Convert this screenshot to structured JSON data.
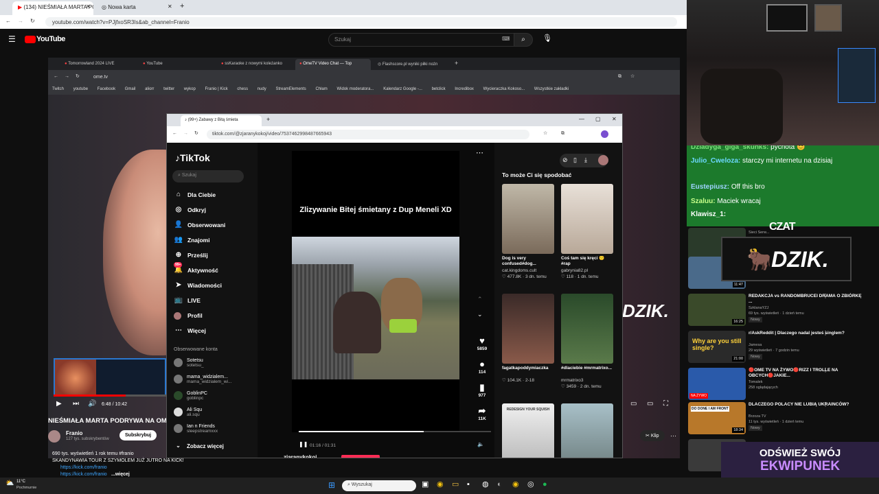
{
  "outer_browser": {
    "tabs": [
      {
        "label": "(134) NIEŚMIAŁA MARTA PODR",
        "active": true
      },
      {
        "label": "Nowa karta",
        "active": false
      }
    ],
    "url": "youtube.com/watch?v=PJjfxoSR3Is&ab_channel=Franio"
  },
  "youtube": {
    "logo": "YouTube",
    "search_placeholder": "Szukaj",
    "video_title": "NIEŚMIAŁA MARTA PODRYWA NA OM",
    "channel": "Franio",
    "subs": "127 tys. subskrybentów",
    "subscribe_label": "Subskrybuj",
    "views_line": "690 tys. wyświetleń  1 rok temu  #franio",
    "desc_line1": "SKANDYNAWIA TOUR Z SZYMOLEM JUŻ JUTRO NA KICK!",
    "desc_link1": "https://kick.com/franio",
    "desc_link2": "https://kick.com/franio",
    "more_label": "...więcej",
    "player_time": "6:48 / 10:42",
    "clip_label": "Klip"
  },
  "inner_browser": {
    "tabs": [
      {
        "label": "Tomorrowland 2024 LIVE",
        "active": false
      },
      {
        "label": "YouTube",
        "active": false
      },
      {
        "label": "ssKaraoke z nowymi koleżanko",
        "active": false
      },
      {
        "label": "OmeTV Video Chat — Top",
        "active": true
      },
      {
        "label": "Flashscore.pl wyniki piłki nożn",
        "active": false
      }
    ],
    "url": "ome.tv",
    "bookmarks": [
      "Twitch",
      "youtube",
      "Facebook",
      "Gmail",
      "aliorr",
      "twitter",
      "wykop",
      "Franio | Kick",
      "chess",
      "nudy",
      "StreamElements",
      "Chłam",
      "Widok moderatora...",
      "Kalendarz Google -...",
      "betclick",
      "Incredibox",
      "Wycieraczka Kokoso...",
      "Wszystkie zakładki"
    ],
    "overlay_text": "DZIK."
  },
  "tiktok": {
    "tab_label": "(99+) Zabawy z Bitą śmieta",
    "url": "tiktok.com/@zjaranykokoj/video/7537462998487665943",
    "logo": "TikTok",
    "search_placeholder": "Szukaj",
    "nav": [
      "Dla Ciebie",
      "Odkryj",
      "Obserwowani",
      "Znajomi",
      "Prześlij",
      "Aktywność",
      "Wiadomości",
      "LIVE",
      "Profil",
      "Więcej"
    ],
    "nav_badge": "99+",
    "following_title": "Obserwowane konta",
    "following": [
      {
        "name": "Sotetsu",
        "handle": "sotetsu_"
      },
      {
        "name": "mama_widzialem...",
        "handle": "mama_widzialem_wi..."
      },
      {
        "name": "GoblinPC",
        "handle": "goblinpc"
      },
      {
        "name": "Ali Squ",
        "handle": "ali.squ"
      },
      {
        "name": "Ian n Friends",
        "handle": "sleepstreamxxx"
      }
    ],
    "see_more": "Zobacz więcej",
    "video_caption": "Zlizywanie Bitej śmietany z Dup Meneli XD",
    "likes": "5859",
    "comments": "114",
    "saves": "977",
    "shares": "11K",
    "time": "01:16 / 01:31",
    "author": "zjaranykokoj",
    "suggest_title": "To może Ci się spodobać",
    "cards": [
      {
        "title": "Dog is very confused#dog...",
        "user": "cat.kingdoms.cult",
        "stats": "♡ 477.8K · 3 dn. temu",
        "color": "#8a7a6a"
      },
      {
        "title": "Coś tam się kręci 🙂 #rap",
        "user": "gabrynia82.pl",
        "stats": "♡ 118 · 1 dn. temu",
        "color": "#d8d0c8"
      },
      {
        "title": "fagatkapoddymiaczka",
        "user": "",
        "stats": "♡ 104.1K · 2-18",
        "color": "#6a4a42"
      },
      {
        "title": "#dlaciebie #mrmatrixo...",
        "user": "mrmatrixo3",
        "stats": "♡ 3459 · 2 dn. temu",
        "color": "#3a5a3a"
      },
      {
        "title": "",
        "user": "",
        "stats": "",
        "color": "#cfcfcf"
      },
      {
        "title": "",
        "user": "",
        "stats": "",
        "color": "#8aa0a8"
      }
    ],
    "card5_text": "REDESIGN YOUR SQUISH"
  },
  "stream": {
    "chat": [
      {
        "name": "Dziadyga_giga_skunks:",
        "text": "pycnota 😊",
        "color": "#7be07b"
      },
      {
        "name": "Julio_Cweloza:",
        "text": "starczy mi internetu na dzisiaj",
        "color": "#6cd9ff"
      },
      {
        "name": "Eustepiusz:",
        "text": "Off this bro",
        "color": "#9fd3ff"
      },
      {
        "name": "Szaluu:",
        "text": "Maciek wracaj",
        "color": "#c7ff8a"
      },
      {
        "name": "Klawisz_1:",
        "text": "",
        "color": "#fff"
      }
    ],
    "chat_label": "CZAT",
    "banner": "DZIK.",
    "promo_line1": "ODŚWIEŻ SWÓJ",
    "promo_line2": "EKWIPUNEK"
  },
  "sidebar_videos": [
    {
      "title": "",
      "channel": "Sieci Serw...",
      "meta": "",
      "dur": "",
      "color": "#2a3a2a",
      "new": ""
    },
    {
      "title": "",
      "channel": "",
      "meta": "",
      "dur": "11:47",
      "color": "#4a6a8a",
      "new": ""
    },
    {
      "title": "REDAKCJA vs RANDOMBRUCEI DRAMA O ZBIÓRKĘ ...",
      "channel": "SzklanaYZJ",
      "meta": "69 tys. wyświetleń · 1 dzień temu",
      "dur": "16:25",
      "color": "#3a4a2a",
      "new": "Nowy"
    },
    {
      "title": "r/AskReddit | Dlaczego nadal jesteś singlem?",
      "channel": "Jamesa",
      "meta": "29 wyświetleń · 7 godzin temu",
      "dur": "21:00",
      "color": "#2a2a2a",
      "new": "Nowy"
    },
    {
      "title": "🔴OME TV NA ŻYWO🔴RIZZ I TROLLE NA OBCYCH🔴JAKIE...",
      "channel": "Tomalek",
      "meta": "258 oglądających",
      "dur": "",
      "color": "#2a5aaa",
      "new": ""
    },
    {
      "title": "DLACZEGO POLACY NIE LUBIĄ UKRAINCÓW?",
      "channel": "Brzoza TV",
      "meta": "11 tys. wyświetleń · 1 dzień temu",
      "dur": "18:34",
      "color": "#b8782a",
      "new": "Nowy"
    },
    {
      "title": "",
      "channel": "",
      "meta": "",
      "dur": "",
      "color": "#3a3a3a",
      "new": ""
    }
  ],
  "sidebar_thumb_text": {
    "single": "Why are you still single?",
    "zywo": "NA ŻYWO",
    "front": "DO DONE I AM FRONT"
  },
  "taskbar": {
    "weather": "11°C",
    "weather_desc": "Pochmurnie",
    "search_placeholder": "Wyszukaj"
  },
  "colors": {
    "yt_red": "#ff0000",
    "tiktok_pink": "#fe2c55",
    "chat_green": "#1c7a2c"
  }
}
